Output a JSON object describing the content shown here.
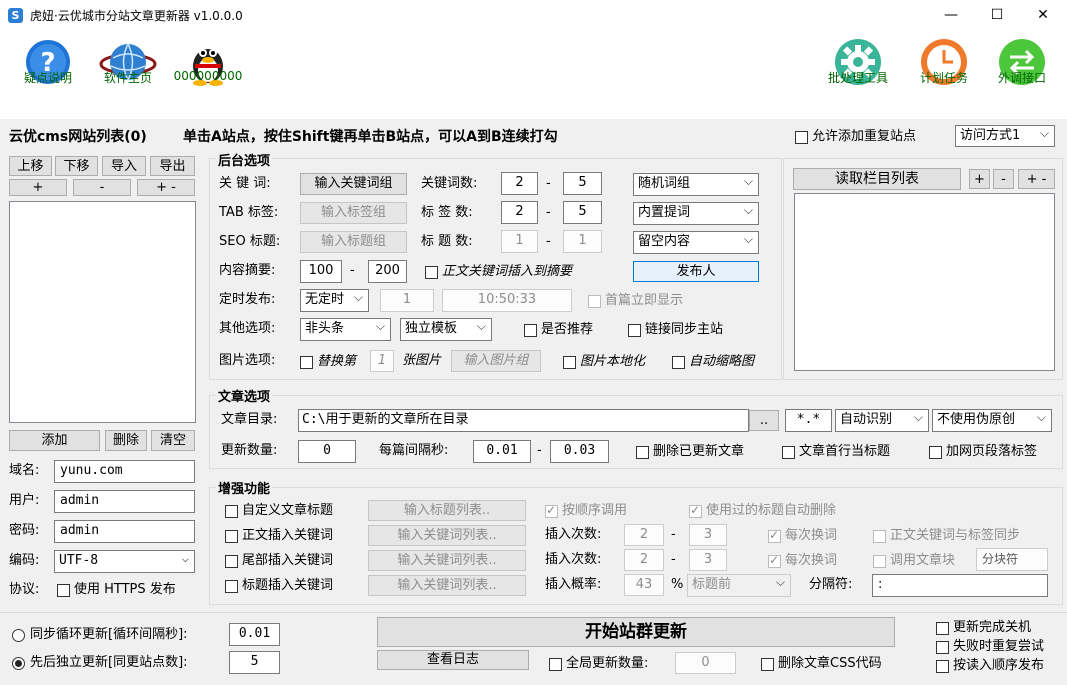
{
  "window": {
    "title": "虎妞·云优城市分站文章更新器 v1.0.0.0",
    "app_icon": "ribbon-logo-icon",
    "minimize": "—",
    "maximize": "☐",
    "close": "✕"
  },
  "toolbar": {
    "help": {
      "label": "疑点说明",
      "icon": "help-question-icon"
    },
    "home": {
      "label": "软件主页",
      "icon": "globe-icon"
    },
    "qq": {
      "label": "000000000",
      "icon": "qq-penguin-icon"
    },
    "batch": {
      "label": "批处理工具",
      "icon": "gear-icon"
    },
    "plan": {
      "label": "计划任务",
      "icon": "clock-icon"
    },
    "external": {
      "label": "外调接口",
      "icon": "exchange-arrows-icon"
    },
    "colors": {
      "label": "#006400",
      "help": "#1e73d6",
      "gear": "#3bb59a",
      "clock": "#f07a2a",
      "external": "#4cc63a"
    }
  },
  "header": {
    "list_title": "云优cms网站列表(0)",
    "hint": "单击A站点，按住Shift键再单击B站点，可以A到B连续打勾",
    "allow_dup": "允许添加重复站点",
    "visit_mode": "访问方式1"
  },
  "left": {
    "up": "上移",
    "down": "下移",
    "import": "导入",
    "export": "导出",
    "plus1": "+",
    "minus1": "-",
    "pm": "+ -",
    "add": "添加",
    "delete": "删除",
    "clear": "清空",
    "domain_label": "域名:",
    "domain": "yunu.com",
    "user_label": "用户:",
    "user": "admin",
    "pass_label": "密码:",
    "pass": "admin",
    "enc_label": "编码:",
    "enc": "UTF-8",
    "proto_label": "协议:",
    "https": "使用 HTTPS 发布"
  },
  "backend": {
    "title": "后台选项",
    "kw_label": "关 键 词:",
    "kw_btn": "输入关键词组",
    "kw_count_label": "关键词数:",
    "kw_min": "2",
    "kw_dash": "-",
    "kw_max": "5",
    "kw_mode": "随机词组",
    "tab_label": "TAB 标签:",
    "tab_btn": "输入标签组",
    "tag_count_label": "标 签 数:",
    "tag_min": "2",
    "tag_max": "5",
    "tag_mode": "内置提词",
    "seo_label": "SEO 标题:",
    "seo_btn": "输入标题组",
    "title_count_label": "标 题 数:",
    "title_min": "1",
    "title_max": "1",
    "title_mode": "留空内容",
    "summary_label": "内容摘要:",
    "sum_min": "100",
    "sum_max": "200",
    "kw_in_summary": "正文关键词插入到摘要",
    "publisher": "发布人",
    "timed_label": "定时发布:",
    "timed": "无定时",
    "timed_n": "1",
    "timed_time": "10:50:33",
    "first_show": "首篇立即显示",
    "other_label": "其他选项:",
    "headline": "非头条",
    "template": "独立模板",
    "recommend": "是否推荐",
    "sync_link": "链接同步主站",
    "img_label": "图片选项:",
    "replace": "替换第",
    "img_n": "1",
    "img_unit": "张图片",
    "img_btn": "输入图片组",
    "img_local": "图片本地化",
    "auto_thumb": "自动缩略图"
  },
  "columns": {
    "read": "读取栏目列表",
    "plus": "+",
    "minus": "-",
    "pm": "+ -"
  },
  "article": {
    "title": "文章选项",
    "dir_label": "文章目录:",
    "dir": "C:\\用于更新的文章所在目录",
    "browse": "..",
    "ext": "*.*",
    "detect": "自动识别",
    "pseudo": "不使用伪原创",
    "update_label": "更新数量:",
    "update": "0",
    "interval_label": "每篇间隔秒:",
    "int_min": "0.01",
    "int_max": "0.03",
    "del_updated": "删除已更新文章",
    "first_line_title": "文章首行当标题",
    "add_para_tag": "加网页段落标签"
  },
  "enhance": {
    "title": "增强功能",
    "custom_title": "自定义文章标题",
    "custom_title_btn": "输入标题列表..",
    "seq": "按顺序调用",
    "auto_del_used": "使用过的标题自动删除",
    "body_kw": "正文插入关键词",
    "body_kw_btn": "输入关键词列表..",
    "ins_count_label": "插入次数:",
    "body_min": "2",
    "body_max": "3",
    "each_swap": "每次换词",
    "body_sync_tag": "正文关键词与标签同步",
    "tail_kw": "尾部插入关键词",
    "tail_kw_btn": "输入关键词列表..",
    "tail_min": "2",
    "tail_max": "3",
    "each_swap2": "每次换词",
    "call_block": "调用文章块",
    "block_sep": "分块符",
    "title_kw": "标题插入关键词",
    "title_kw_btn": "输入关键词列表..",
    "prob_label": "插入概率:",
    "prob": "43",
    "pct": "%",
    "pos": "标题前",
    "sep_label": "分隔符:",
    "sep": ":"
  },
  "bottom": {
    "sync_loop": "同步循环更新[循环间隔秒]:",
    "loop_sec": "0.01",
    "seq_update": "先后独立更新[同更站点数]:",
    "site_num": "5",
    "start": "开始站群更新",
    "log": "查看日志",
    "global_count_label": "全局更新数量:",
    "global_count": "0",
    "del_css": "删除文章CSS代码",
    "shutdown": "更新完成关机",
    "retry": "失败时重复尝试",
    "read_order": "按读入顺序发布"
  }
}
